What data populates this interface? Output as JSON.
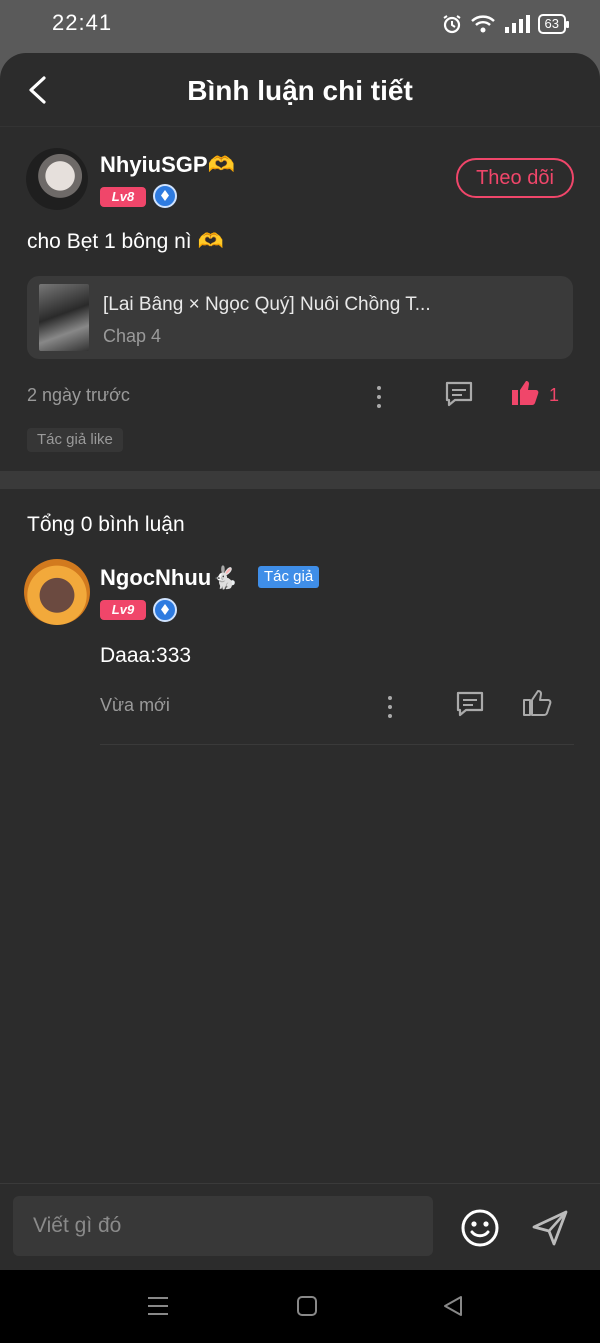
{
  "status": {
    "time": "22:41",
    "battery": "63"
  },
  "header": {
    "title": "Bình luận chi tiết"
  },
  "post": {
    "username": "NhyiuSGP🫶",
    "level": "Lv8",
    "follow_label": "Theo dõi",
    "content": "cho Bẹt 1 bông nì 🫶",
    "linked": {
      "title": "[Lai Bâng × Ngọc Quý] Nuôi Chồng T...",
      "chapter": "Chap 4"
    },
    "time": "2 ngày trước",
    "like_count": "1",
    "tag": "Tác giả like",
    "accent_color": "#f0466a"
  },
  "comments_section": {
    "total_label": "Tổng 0 bình luận",
    "items": [
      {
        "username": "NgocNhuu🐇",
        "author_badge": "Tác giả",
        "level": "Lv9",
        "content": "Daaa:333",
        "time": "Vừa mới"
      }
    ]
  },
  "composer": {
    "placeholder": "Viết gì đó"
  }
}
